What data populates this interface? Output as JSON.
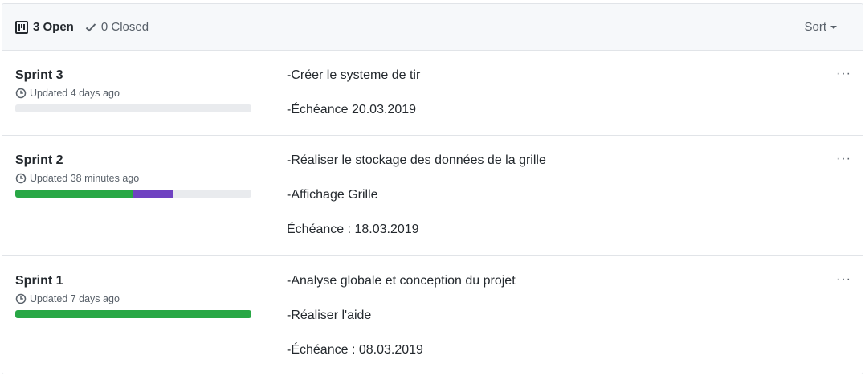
{
  "header": {
    "open_label": "3 Open",
    "closed_label": "0 Closed",
    "sort_label": "Sort"
  },
  "projects": [
    {
      "title": "Sprint 3",
      "updated": "Updated 4 days ago",
      "description": [
        "-Créer le systeme de tir",
        "-Échéance 20.03.2019"
      ],
      "progress": {
        "done": 0,
        "in_progress": 0
      }
    },
    {
      "title": "Sprint 2",
      "updated": "Updated 38 minutes ago",
      "description": [
        "-Réaliser le stockage des données de la grille",
        "-Affichage Grille",
        "Échéance : 18.03.2019"
      ],
      "progress": {
        "done": 0.5,
        "in_progress": 0.17
      }
    },
    {
      "title": "Sprint 1",
      "updated": "Updated 7 days ago",
      "description": [
        "-Analyse globale et conception du projet",
        "-Réaliser l'aide",
        "-Échéance : 08.03.2019"
      ],
      "progress": {
        "done": 1.0,
        "in_progress": 0
      }
    }
  ],
  "colors": {
    "done": "#28a745",
    "in_progress": "#6f42c1",
    "track": "#e9ebee"
  },
  "more_label": "···",
  "icons": {
    "open": "project-icon",
    "closed": "check-icon",
    "updated": "clock-icon",
    "menu": "kebab-icon"
  }
}
